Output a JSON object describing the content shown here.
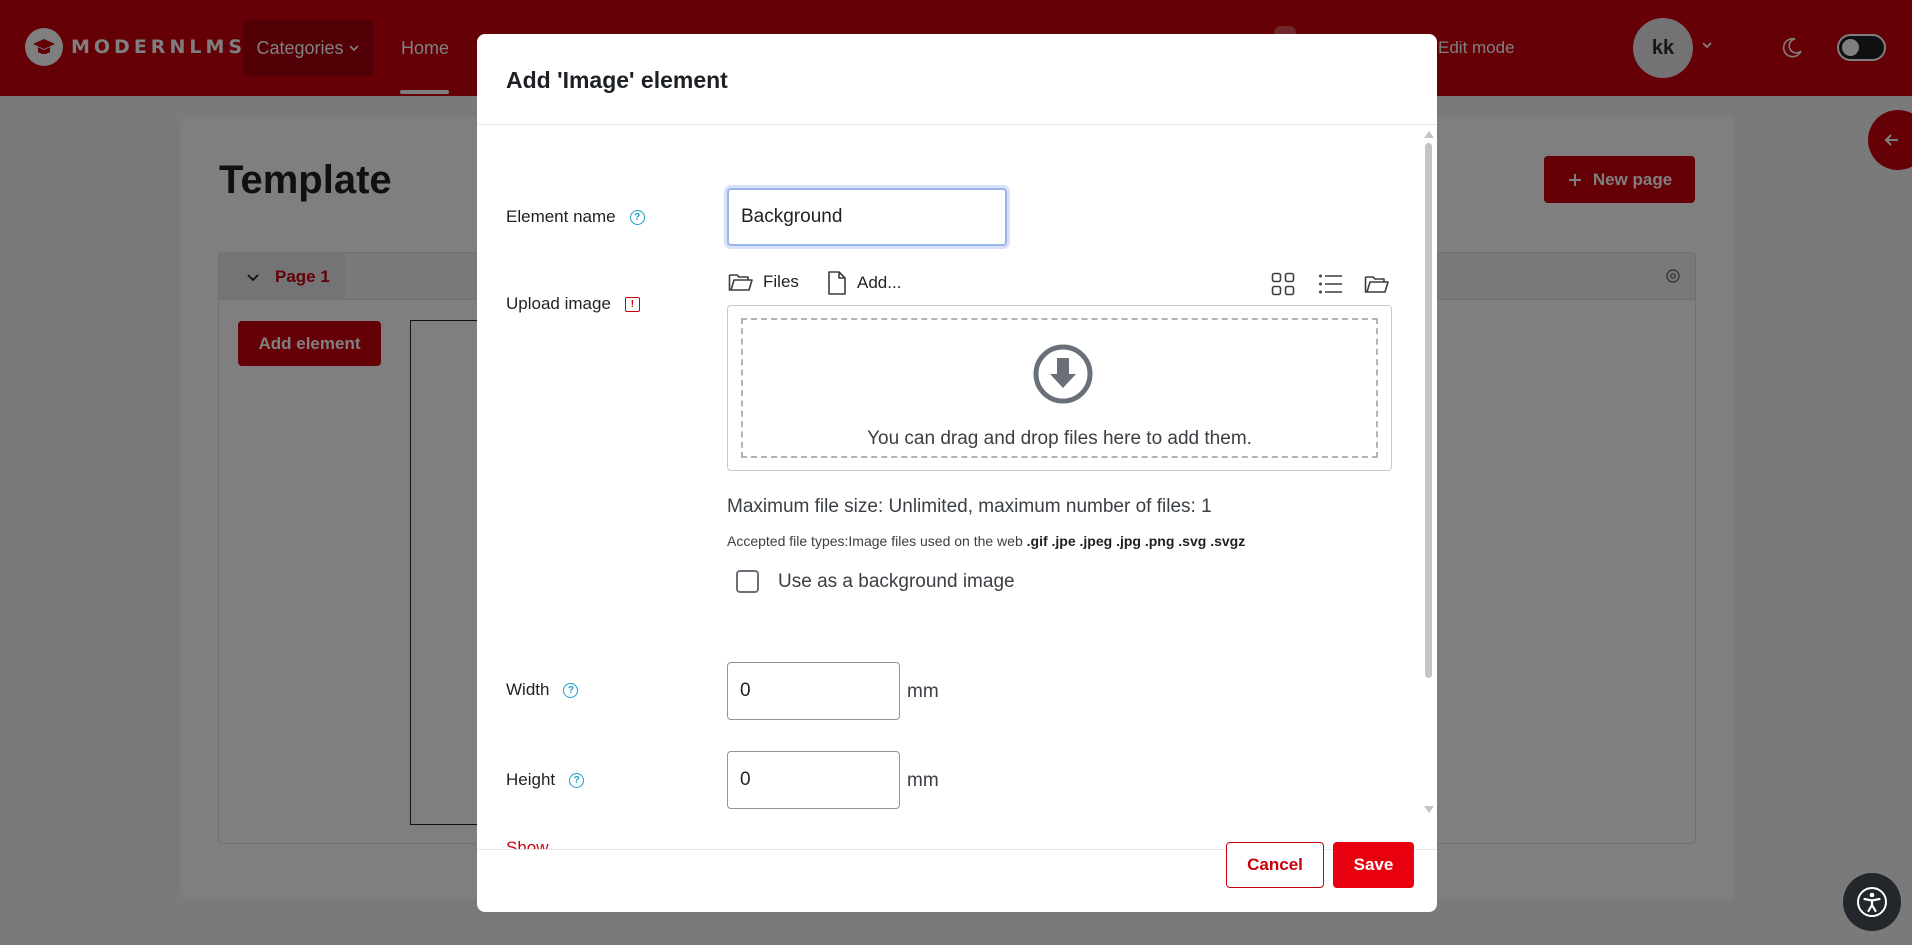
{
  "navbar": {
    "brand": "MODERNLMS",
    "categories_label": "Categories",
    "home_label": "Home",
    "mode_label": "Edit mode",
    "user_initials": "kk"
  },
  "page": {
    "title": "Template",
    "new_page_label": "New page",
    "page_tab_label": "Page 1",
    "add_element_label": "Add element"
  },
  "modal": {
    "title": "Add 'Image' element",
    "element_name_label": "Element name",
    "element_name_value": "Background",
    "upload_image_label": "Upload image",
    "filepicker": {
      "files_label": "Files",
      "add_label": "Add...",
      "drop_text": "You can drag and drop files here to add them."
    },
    "file_info": "Maximum file size: Unlimited, maximum number of files: 1",
    "accepted_prefix": "Accepted file types:",
    "accepted_desc": "Image files used on the web ",
    "accepted_ext": ".gif .jpe .jpeg .jpg .png .svg .svgz",
    "background_checkbox_label": "Use as a background image",
    "background_checked": false,
    "width_label": "Width",
    "width_value": "0",
    "height_label": "Height",
    "height_value": "0",
    "unit": "mm",
    "cut_label": "Show",
    "cancel_label": "Cancel",
    "save_label": "Save"
  },
  "colors": {
    "brand": "#c8000c",
    "save": "#e8000e",
    "help": "#1a9fc6"
  },
  "icons": [
    "logo-icon",
    "chevron-down-icon",
    "moon-icon",
    "plus-icon",
    "gear-icon",
    "arrow-left-icon",
    "help-icon",
    "required-icon",
    "folder-icon",
    "file-icon",
    "grid-view-icon",
    "list-view-icon",
    "folder-tree-icon",
    "download-circle-icon",
    "accessibility-icon"
  ]
}
